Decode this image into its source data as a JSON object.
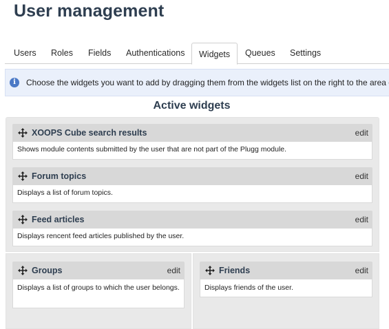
{
  "page_title": "User management",
  "tabs": [
    {
      "label": "Users"
    },
    {
      "label": "Roles"
    },
    {
      "label": "Fields"
    },
    {
      "label": "Authentications"
    },
    {
      "label": "Widgets",
      "active": true
    },
    {
      "label": "Queues"
    },
    {
      "label": "Settings"
    }
  ],
  "info": {
    "icon": "info-icon",
    "text": "Choose the widgets you want to add by dragging them from the widgets list on the right to the area o"
  },
  "active_widgets": {
    "title": "Active widgets",
    "edit_label": "edit",
    "move_icon": "move-icon",
    "main": [
      {
        "title": "XOOPS Cube search results",
        "description": "Shows module contents submitted by the user that are not part of the Plugg module."
      },
      {
        "title": "Forum topics",
        "description": "Displays a list of forum topics."
      },
      {
        "title": "Feed articles",
        "description": "Displays rencent feed articles published by the user."
      }
    ],
    "left": [
      {
        "title": "Groups",
        "description": "Displays a list of groups to which the user belongs."
      }
    ],
    "right": [
      {
        "title": "Friends",
        "description": "Displays friends of the user."
      }
    ]
  },
  "colors": {
    "heading": "#2e3e50",
    "info_background": "#eaf0fb",
    "info_icon": "#4b79c6",
    "widget_header": "#d8d8d8",
    "area_background": "#e9e9e9"
  }
}
